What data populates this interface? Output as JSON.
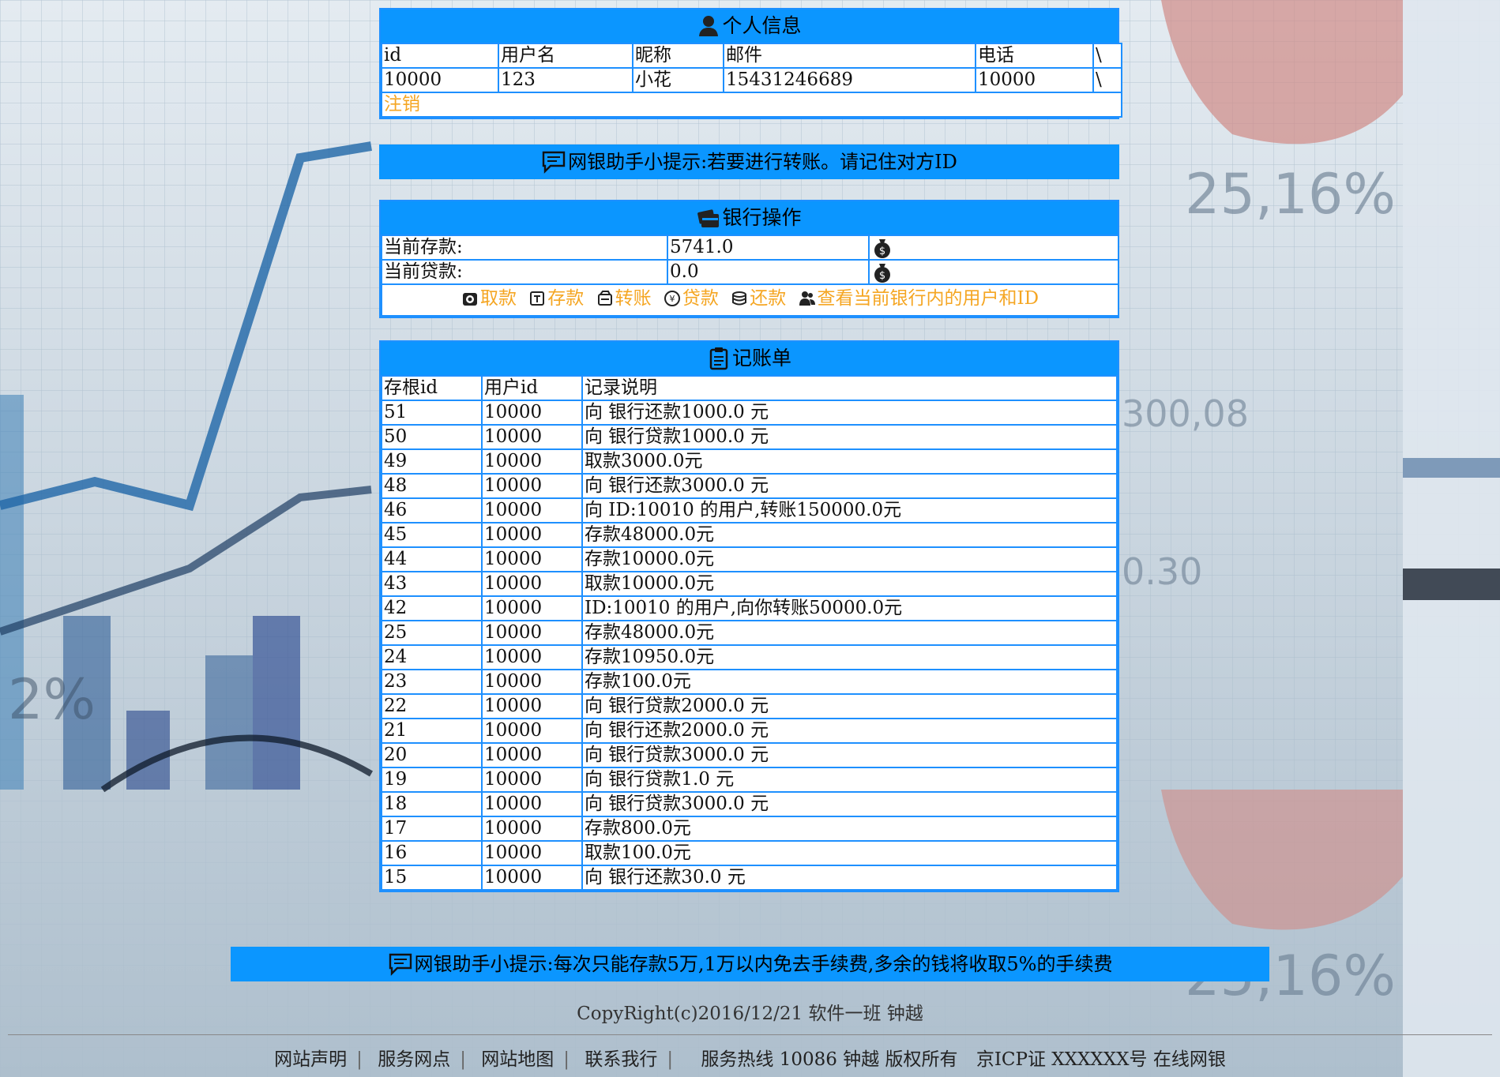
{
  "profile": {
    "title": "个人信息",
    "headers": [
      "id",
      "用户名",
      "昵称",
      "邮件",
      "电话",
      "\\"
    ],
    "values": [
      "10000",
      "123",
      "小花",
      "15431246689",
      "10000",
      "\\"
    ],
    "logout": "注销"
  },
  "tip1": "网银助手小提示:若要进行转账。请记住对方ID",
  "bank": {
    "title": "银行操作",
    "deposit_label": "当前存款:",
    "deposit_value": "5741.0",
    "loan_label": "当前贷款:",
    "loan_value": "0.0",
    "ops": [
      "取款",
      "存款",
      "转账",
      "贷款",
      "还款",
      "查看当前银行内的用户和ID"
    ]
  },
  "ledger": {
    "title": "记账单",
    "headers": [
      "存根id",
      "用户id",
      "记录说明"
    ],
    "rows": [
      [
        "51",
        "10000",
        "向 银行还款1000.0 元"
      ],
      [
        "50",
        "10000",
        "向 银行贷款1000.0 元"
      ],
      [
        "49",
        "10000",
        "取款3000.0元"
      ],
      [
        "48",
        "10000",
        "向 银行还款3000.0 元"
      ],
      [
        "46",
        "10000",
        "向 ID:10010 的用户,转账150000.0元"
      ],
      [
        "45",
        "10000",
        "存款48000.0元"
      ],
      [
        "44",
        "10000",
        "存款10000.0元"
      ],
      [
        "43",
        "10000",
        "取款10000.0元"
      ],
      [
        "42",
        "10000",
        "ID:10010 的用户,向你转账50000.0元"
      ],
      [
        "25",
        "10000",
        "存款48000.0元"
      ],
      [
        "24",
        "10000",
        "存款10950.0元"
      ],
      [
        "23",
        "10000",
        "存款100.0元"
      ],
      [
        "22",
        "10000",
        "向 银行贷款2000.0 元"
      ],
      [
        "21",
        "10000",
        "向 银行还款2000.0 元"
      ],
      [
        "20",
        "10000",
        "向 银行贷款3000.0 元"
      ],
      [
        "19",
        "10000",
        "向 银行贷款1.0 元"
      ],
      [
        "18",
        "10000",
        "向 银行贷款3000.0 元"
      ],
      [
        "17",
        "10000",
        "存款800.0元"
      ],
      [
        "16",
        "10000",
        "取款100.0元"
      ],
      [
        "15",
        "10000",
        "向 银行还款30.0 元"
      ]
    ]
  },
  "tip2": "网银助手小提示:每次只能存款5万,1万以内免去手续费,多余的钱将收取5%的手续费",
  "copyright": "CopyRight(c)2016/12/21 软件一班 钟越",
  "footer": {
    "links": [
      "网站声明",
      "服务网点",
      "网站地图",
      "联系我行"
    ],
    "hotline": "服务热线 10086 钟越 版权所有",
    "icp": "京ICP证 XXXXXX号 在线网银"
  },
  "colors": {
    "header_blue": "#0b96ff",
    "border_blue": "#1e90ff",
    "link_orange": "#f5a623"
  }
}
